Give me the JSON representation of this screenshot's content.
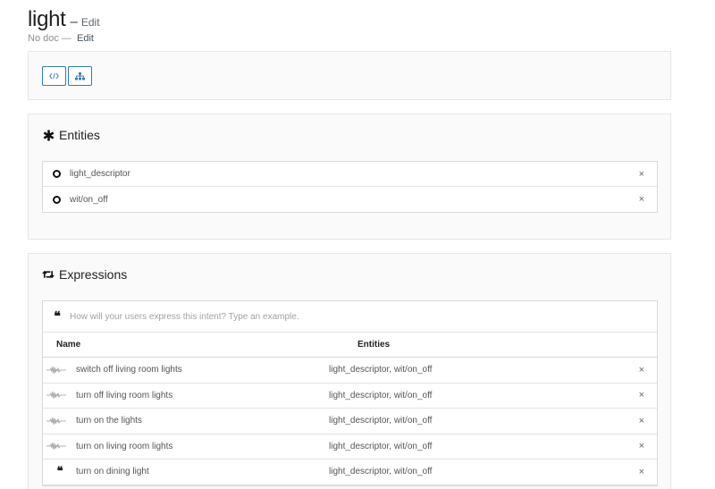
{
  "intent": {
    "name": "light",
    "dash": "–",
    "edit_label": "Edit",
    "doc_text": "No doc",
    "doc_dash": "—",
    "doc_edit_label": "Edit"
  },
  "toolbar": {
    "code_icon": "code-icon",
    "tree_icon": "sitemap-icon",
    "accent_color": "#2f7bbf"
  },
  "entities": {
    "title": "Entities",
    "icon": "asterisk-icon",
    "items": [
      {
        "label": "light_descriptor",
        "remove": "×"
      },
      {
        "label": "wit/on_off",
        "remove": "×"
      }
    ]
  },
  "expressions": {
    "title": "Expressions",
    "icon": "retweet-icon",
    "input_placeholder": "How will your users express this intent? Type an example.",
    "columns": {
      "name": "Name",
      "entities": "Entities"
    },
    "rows": [
      {
        "text": "switch off living room lights",
        "entities": "light_descriptor, wit/on_off",
        "icon": "waveform-icon",
        "remove": "×"
      },
      {
        "text": "turn off living room lights",
        "entities": "light_descriptor, wit/on_off",
        "icon": "waveform-icon",
        "remove": "×"
      },
      {
        "text": "turn on the lights",
        "entities": "light_descriptor, wit/on_off",
        "icon": "waveform-icon",
        "remove": "×"
      },
      {
        "text": "turn on living room lights",
        "entities": "light_descriptor, wit/on_off",
        "icon": "waveform-icon",
        "remove": "×"
      },
      {
        "text": "turn on dining light",
        "entities": "light_descriptor, wit/on_off",
        "icon": "quote-icon",
        "remove": "×"
      }
    ]
  }
}
